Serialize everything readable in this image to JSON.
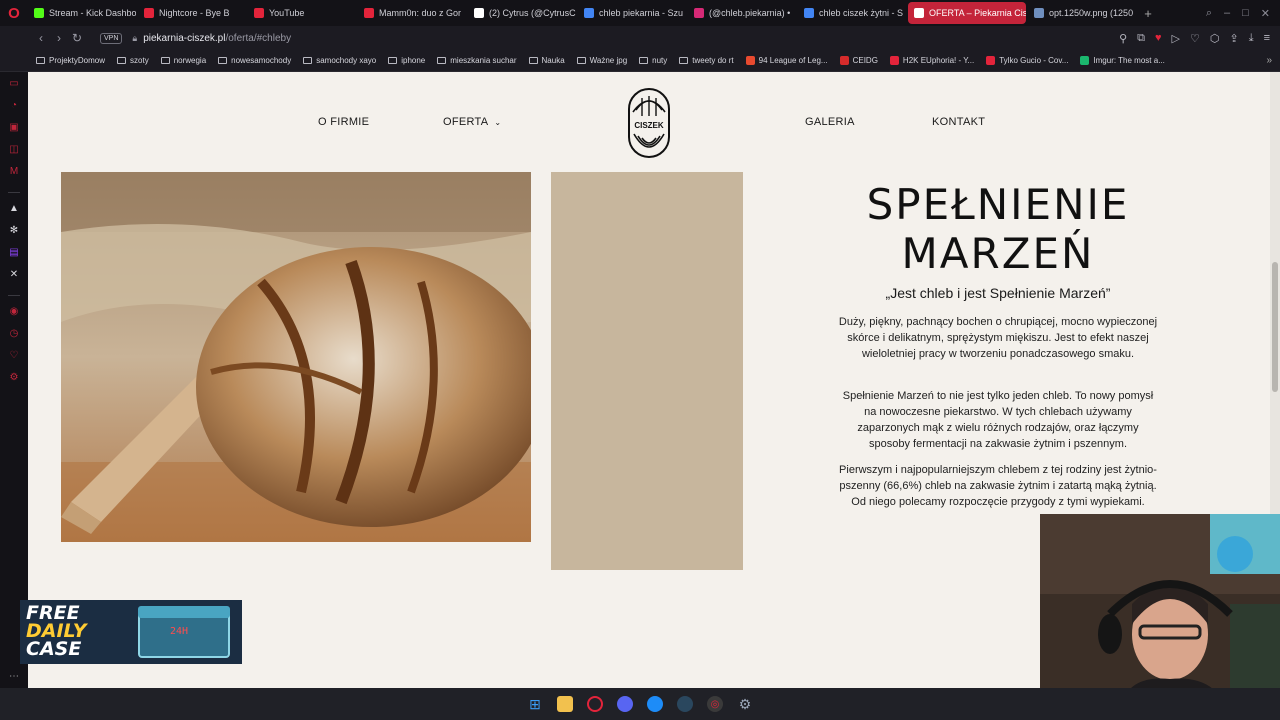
{
  "browser": {
    "tabs": [
      {
        "label": "Stream - Kick Dashbo",
        "color": "#53fc18"
      },
      {
        "label": "Nightcore - Bye B",
        "color": "#e3243b"
      },
      {
        "label": "YouTube",
        "color": "#e3243b"
      },
      {
        "label": "Mamm0n: duo z Gor",
        "color": "#e3243b"
      },
      {
        "label": "(2) Cytrus (@CytrusC",
        "color": "#ffffff"
      },
      {
        "label": "chleb piekarnia - Szu",
        "color": "#4285f4"
      },
      {
        "label": "(@chleb.piekarnia) •",
        "color": "#d62976"
      },
      {
        "label": "chleb ciszek żytni - S",
        "color": "#4285f4"
      },
      {
        "label": "OFERTA – Piekarnia Cisz",
        "color": "#c4243a",
        "active": true
      },
      {
        "label": "opt.1250w.png (1250",
        "color": "#6f8fbf"
      }
    ],
    "new_tab": "+",
    "address": {
      "vpn": "VPN",
      "domain": "piekarnia-ciszek.pl",
      "path": "/oferta/#chleby"
    },
    "bookmarks": [
      {
        "label": "ProjektyDomow",
        "type": "folder"
      },
      {
        "label": "szoty",
        "type": "folder"
      },
      {
        "label": "norwegia",
        "type": "folder"
      },
      {
        "label": "nowesamochody",
        "type": "folder"
      },
      {
        "label": "samochody xayo",
        "type": "folder"
      },
      {
        "label": "iphone",
        "type": "folder"
      },
      {
        "label": "mieszkania suchar",
        "type": "folder"
      },
      {
        "label": "Nauka",
        "type": "folder"
      },
      {
        "label": "Ważne jpg",
        "type": "folder"
      },
      {
        "label": "nuty",
        "type": "folder"
      },
      {
        "label": "tweety do rt",
        "type": "folder"
      },
      {
        "label": "94 League of Leg...",
        "type": "site",
        "color": "#e84a2f"
      },
      {
        "label": "CEIDG",
        "type": "site",
        "color": "#d62b2b"
      },
      {
        "label": "H2K EUphoria! - Y...",
        "type": "site",
        "color": "#e3243b"
      },
      {
        "label": "Tylko Gucio - Cov...",
        "type": "site",
        "color": "#e3243b"
      },
      {
        "label": "Imgur: The most a...",
        "type": "site",
        "color": "#1bb76e"
      }
    ],
    "bookmarks_more": "»"
  },
  "site": {
    "menu": {
      "o_firmie": "O FIRMIE",
      "oferta": "OFERTA",
      "galeria": "GALERIA",
      "kontakt": "KONTAKT"
    },
    "logo_text": "CISZEK",
    "title": "SPEŁNIENIE MARZEŃ",
    "quote": "„Jest chleb i jest Spełnienie Marzeń”",
    "paragraphs": [
      "Duży, piękny, pachnący bochen o chrupiącej, mocno wypieczonej skórce i delikatnym, sprężystym miękiszu. Jest to efekt naszej wieloletniej pracy w tworzeniu ponadczasowego smaku.",
      "Spełnienie Marzeń to nie jest tylko jeden chleb. To nowy pomysł na nowoczesne piekarstwo. W tych chlebach używamy zaparzonych mąk z wielu różnych rodzajów, oraz łączymy sposoby fermentacji na zakwasie żytnim i pszennym.",
      "Pierwszym i najpopularniejszym chlebem z tej rodziny jest żytnio-pszenny (66,6%) chleb na zakwasie żytnim i zatartą mąką żytnią. Od niego polecamy rozpoczęcie przygody z tymi wypiekami."
    ],
    "colors": {
      "background": "#f4f1ec",
      "beige_panel": "#c7b69d"
    }
  },
  "overlay_ad": {
    "line1": "FREE",
    "line2": "DAILY",
    "line3": "CASE",
    "timer": "24H"
  }
}
